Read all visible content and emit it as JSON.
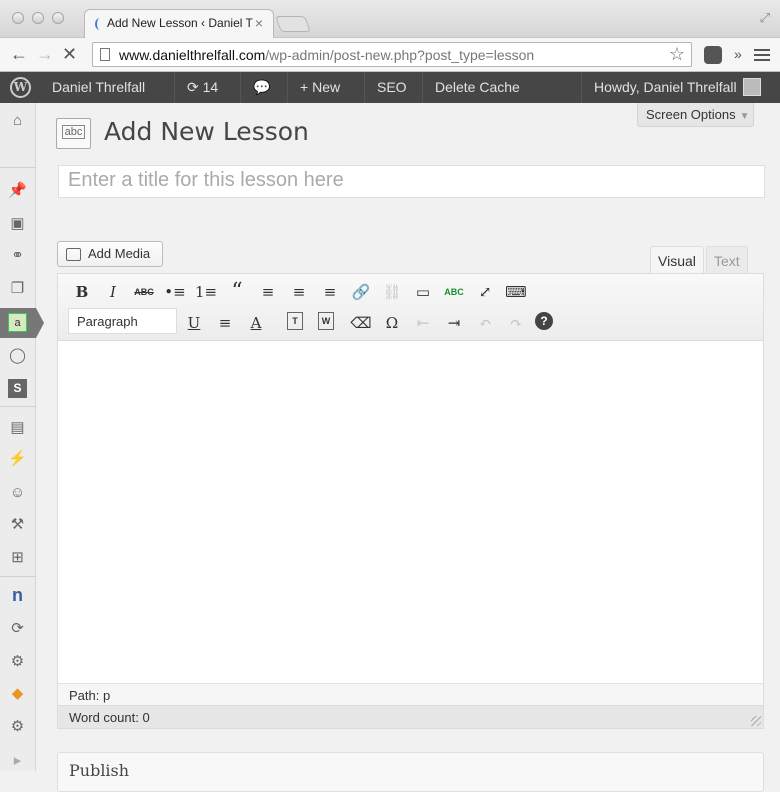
{
  "browser": {
    "tab_title": "Add New Lesson ‹ Daniel T",
    "url_host": "www.danielthrelfall.com",
    "url_path": "/wp-admin/post-new.php?post_type=lesson"
  },
  "adminbar": {
    "site_name": "Daniel Threlfall",
    "updates_count": "14",
    "new_label": "New",
    "seo_label": "SEO",
    "delete_cache_label": "Delete Cache",
    "howdy": "Howdy, Daniel Threlfall"
  },
  "sidebar": {
    "icons": [
      "dashboard-icon",
      "pin-icon",
      "media-icon",
      "links-icon",
      "pages-icon",
      "lessons-icon",
      "comments-icon",
      "s-icon",
      "appearance-icon",
      "plugins-icon",
      "users-icon",
      "tools-icon",
      "settings-icon",
      "n-icon",
      "refresh-icon",
      "gear-icon",
      "plugin-orange-icon",
      "gear-2-icon",
      "collapse-icon"
    ]
  },
  "page": {
    "screen_options": "Screen Options",
    "title": "Add New Lesson",
    "title_placeholder": "Enter a title for this lesson here",
    "add_media": "Add Media",
    "tab_visual": "Visual",
    "tab_text": "Text",
    "format_select": "Paragraph",
    "path": "Path: p",
    "word_count": "Word count: 0",
    "publish_title": "Publish"
  },
  "editor_toolbar": {
    "row1": [
      "B",
      "I",
      "ABC",
      "•≡",
      "1≡",
      "“",
      "≡",
      "≡",
      "≡",
      "🔗",
      "⛓",
      "▭",
      "ABC",
      "⤢",
      "⌨"
    ],
    "row2": [
      "U",
      "≡",
      "A",
      "T",
      "W",
      "⌫",
      "Ω",
      "⇤",
      "⇥",
      "↶",
      "↷",
      "?"
    ]
  }
}
